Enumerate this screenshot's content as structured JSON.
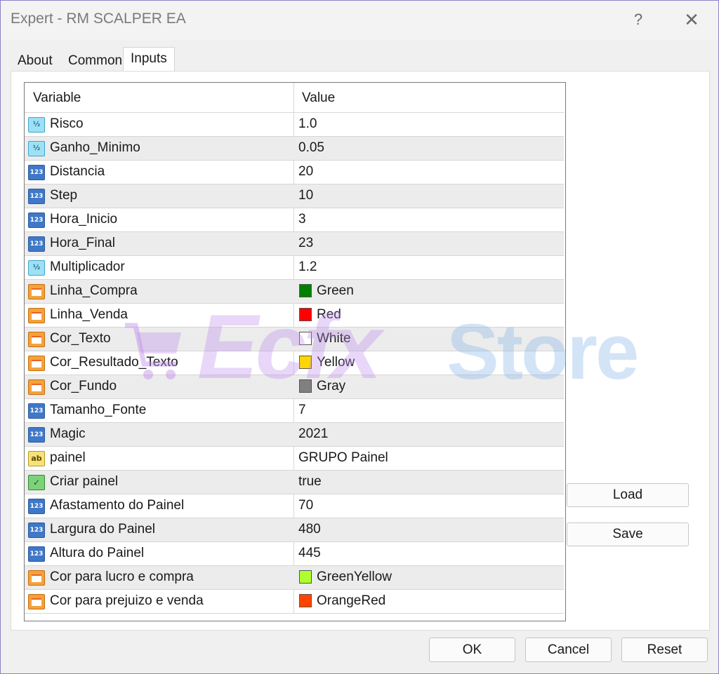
{
  "window": {
    "title": "Expert - RM SCALPER EA",
    "help_label": "?",
    "close_label": "✕"
  },
  "tabs": [
    {
      "label": "About",
      "active": false
    },
    {
      "label": "Common",
      "active": false
    },
    {
      "label": "Inputs",
      "active": true
    }
  ],
  "grid": {
    "columns": [
      "Variable",
      "Value"
    ],
    "rows": [
      {
        "icon": "double-icon",
        "variable": "Risco",
        "value": "1.0"
      },
      {
        "icon": "double-icon",
        "variable": "Ganho_Minimo",
        "value": "0.05"
      },
      {
        "icon": "int-icon",
        "variable": "Distancia",
        "value": "20"
      },
      {
        "icon": "int-icon",
        "variable": "Step",
        "value": "10"
      },
      {
        "icon": "int-icon",
        "variable": "Hora_Inicio",
        "value": "3"
      },
      {
        "icon": "int-icon",
        "variable": "Hora_Final",
        "value": "23"
      },
      {
        "icon": "double-icon",
        "variable": "Multiplicador",
        "value": "1.2"
      },
      {
        "icon": "color-icon",
        "variable": "Linha_Compra",
        "value": "Green",
        "color": "#008000"
      },
      {
        "icon": "color-icon",
        "variable": "Linha_Venda",
        "value": "Red",
        "color": "#ff0000"
      },
      {
        "icon": "color-icon",
        "variable": "Cor_Texto",
        "value": "White",
        "color": "#ffffff"
      },
      {
        "icon": "color-icon",
        "variable": "Cor_Resultado_Texto",
        "value": "Yellow",
        "color": "#ffd700"
      },
      {
        "icon": "color-icon",
        "variable": "Cor_Fundo",
        "value": "Gray",
        "color": "#808080"
      },
      {
        "icon": "int-icon",
        "variable": "Tamanho_Fonte",
        "value": "7"
      },
      {
        "icon": "int-icon",
        "variable": "Magic",
        "value": "2021"
      },
      {
        "icon": "string-icon",
        "variable": "painel",
        "value": "GRUPO Painel"
      },
      {
        "icon": "bool-icon",
        "variable": "Criar painel",
        "value": "true"
      },
      {
        "icon": "int-icon",
        "variable": "Afastamento do Painel",
        "value": "70"
      },
      {
        "icon": "int-icon",
        "variable": "Largura do Painel",
        "value": "480"
      },
      {
        "icon": "int-icon",
        "variable": "Altura do Painel",
        "value": "445"
      },
      {
        "icon": "color-icon",
        "variable": "Cor para lucro e compra",
        "value": "GreenYellow",
        "color": "#adff2f"
      },
      {
        "icon": "color-icon",
        "variable": "Cor para prejuizo e venda",
        "value": "OrangeRed",
        "color": "#ff4500"
      }
    ]
  },
  "side_buttons": {
    "load": "Load",
    "save": "Save"
  },
  "footer_buttons": {
    "ok": "OK",
    "cancel": "Cancel",
    "reset": "Reset"
  },
  "watermark": {
    "part1": "Ecfx",
    "part2": "Store"
  }
}
